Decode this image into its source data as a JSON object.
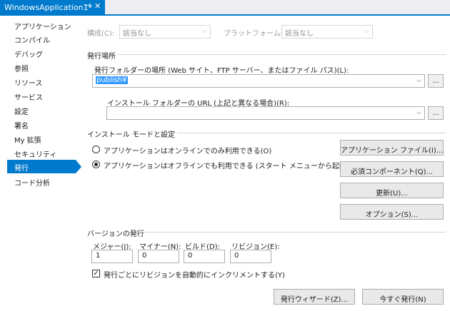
{
  "tab": {
    "title": "WindowsApplication1*",
    "pin": "⊣",
    "close": "✕"
  },
  "sidebar": {
    "items": [
      {
        "label": "アプリケーション"
      },
      {
        "label": "コンパイル"
      },
      {
        "label": "デバッグ"
      },
      {
        "label": "参照"
      },
      {
        "label": "リソース"
      },
      {
        "label": "サービス"
      },
      {
        "label": "設定"
      },
      {
        "label": "署名"
      },
      {
        "label": "My 拡張"
      },
      {
        "label": "セキュリティ"
      },
      {
        "label": "発行"
      },
      {
        "label": "コード分析"
      }
    ],
    "active": "発行"
  },
  "config": {
    "config_label": "構成(C):",
    "config_value": "該当なし",
    "platform_label": "プラットフォーム(M):",
    "platform_value": "該当なし"
  },
  "publish_location": {
    "group_title": "発行場所",
    "folder_label": "発行フォルダーの場所 (Web サイト、FTP サーバー、またはファイル パス)(L):",
    "folder_value": "publish¥",
    "browse": "...",
    "install_url_label": "インストール フォルダーの URL (上記と異なる場合)(R):",
    "install_url_value": ""
  },
  "install_mode": {
    "group_title": "インストール モードと設定",
    "online_only": "アプリケーションはオンラインでのみ利用できる(O)",
    "offline": "アプリケーションはオフラインでも利用できる (スタート メニューから起動可能)(M)",
    "selected": "offline",
    "buttons": {
      "app_files": "アプリケーション ファイル(I)...",
      "prerequisites": "必須コンポーネント(Q)...",
      "updates": "更新(U)...",
      "options": "オプション(S)..."
    }
  },
  "version": {
    "group_title": "バージョンの発行",
    "major_label": "メジャー(J):",
    "minor_label": "マイナー(N):",
    "build_label": "ビルド(D):",
    "revision_label": "リビジョン(E):",
    "major": "1",
    "minor": "0",
    "build": "0",
    "revision": "0",
    "auto_increment_label": "発行ごとにリビジョンを自動的にインクリメントする(Y)",
    "auto_increment_checked": true,
    "check_mark": "✓"
  },
  "footer": {
    "wizard": "発行ウィザード(Z)...",
    "publish_now": "今すぐ発行(N)"
  },
  "icons": {
    "dropdown": "chevron-down-icon",
    "pin": "pin-icon",
    "close": "close-icon"
  },
  "colors": {
    "accent": "#007acc",
    "selection": "#3399ff"
  }
}
